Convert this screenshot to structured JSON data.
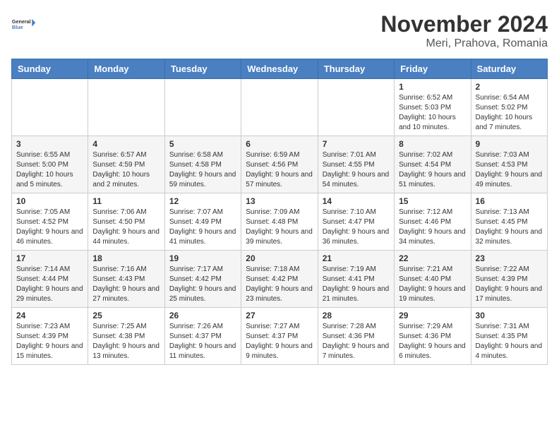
{
  "logo": {
    "line1": "General",
    "line2": "Blue"
  },
  "title": "November 2024",
  "location": "Meri, Prahova, Romania",
  "days_of_week": [
    "Sunday",
    "Monday",
    "Tuesday",
    "Wednesday",
    "Thursday",
    "Friday",
    "Saturday"
  ],
  "weeks": [
    [
      {
        "day": "",
        "info": ""
      },
      {
        "day": "",
        "info": ""
      },
      {
        "day": "",
        "info": ""
      },
      {
        "day": "",
        "info": ""
      },
      {
        "day": "",
        "info": ""
      },
      {
        "day": "1",
        "info": "Sunrise: 6:52 AM\nSunset: 5:03 PM\nDaylight: 10 hours and 10 minutes."
      },
      {
        "day": "2",
        "info": "Sunrise: 6:54 AM\nSunset: 5:02 PM\nDaylight: 10 hours and 7 minutes."
      }
    ],
    [
      {
        "day": "3",
        "info": "Sunrise: 6:55 AM\nSunset: 5:00 PM\nDaylight: 10 hours and 5 minutes."
      },
      {
        "day": "4",
        "info": "Sunrise: 6:57 AM\nSunset: 4:59 PM\nDaylight: 10 hours and 2 minutes."
      },
      {
        "day": "5",
        "info": "Sunrise: 6:58 AM\nSunset: 4:58 PM\nDaylight: 9 hours and 59 minutes."
      },
      {
        "day": "6",
        "info": "Sunrise: 6:59 AM\nSunset: 4:56 PM\nDaylight: 9 hours and 57 minutes."
      },
      {
        "day": "7",
        "info": "Sunrise: 7:01 AM\nSunset: 4:55 PM\nDaylight: 9 hours and 54 minutes."
      },
      {
        "day": "8",
        "info": "Sunrise: 7:02 AM\nSunset: 4:54 PM\nDaylight: 9 hours and 51 minutes."
      },
      {
        "day": "9",
        "info": "Sunrise: 7:03 AM\nSunset: 4:53 PM\nDaylight: 9 hours and 49 minutes."
      }
    ],
    [
      {
        "day": "10",
        "info": "Sunrise: 7:05 AM\nSunset: 4:52 PM\nDaylight: 9 hours and 46 minutes."
      },
      {
        "day": "11",
        "info": "Sunrise: 7:06 AM\nSunset: 4:50 PM\nDaylight: 9 hours and 44 minutes."
      },
      {
        "day": "12",
        "info": "Sunrise: 7:07 AM\nSunset: 4:49 PM\nDaylight: 9 hours and 41 minutes."
      },
      {
        "day": "13",
        "info": "Sunrise: 7:09 AM\nSunset: 4:48 PM\nDaylight: 9 hours and 39 minutes."
      },
      {
        "day": "14",
        "info": "Sunrise: 7:10 AM\nSunset: 4:47 PM\nDaylight: 9 hours and 36 minutes."
      },
      {
        "day": "15",
        "info": "Sunrise: 7:12 AM\nSunset: 4:46 PM\nDaylight: 9 hours and 34 minutes."
      },
      {
        "day": "16",
        "info": "Sunrise: 7:13 AM\nSunset: 4:45 PM\nDaylight: 9 hours and 32 minutes."
      }
    ],
    [
      {
        "day": "17",
        "info": "Sunrise: 7:14 AM\nSunset: 4:44 PM\nDaylight: 9 hours and 29 minutes."
      },
      {
        "day": "18",
        "info": "Sunrise: 7:16 AM\nSunset: 4:43 PM\nDaylight: 9 hours and 27 minutes."
      },
      {
        "day": "19",
        "info": "Sunrise: 7:17 AM\nSunset: 4:42 PM\nDaylight: 9 hours and 25 minutes."
      },
      {
        "day": "20",
        "info": "Sunrise: 7:18 AM\nSunset: 4:42 PM\nDaylight: 9 hours and 23 minutes."
      },
      {
        "day": "21",
        "info": "Sunrise: 7:19 AM\nSunset: 4:41 PM\nDaylight: 9 hours and 21 minutes."
      },
      {
        "day": "22",
        "info": "Sunrise: 7:21 AM\nSunset: 4:40 PM\nDaylight: 9 hours and 19 minutes."
      },
      {
        "day": "23",
        "info": "Sunrise: 7:22 AM\nSunset: 4:39 PM\nDaylight: 9 hours and 17 minutes."
      }
    ],
    [
      {
        "day": "24",
        "info": "Sunrise: 7:23 AM\nSunset: 4:39 PM\nDaylight: 9 hours and 15 minutes."
      },
      {
        "day": "25",
        "info": "Sunrise: 7:25 AM\nSunset: 4:38 PM\nDaylight: 9 hours and 13 minutes."
      },
      {
        "day": "26",
        "info": "Sunrise: 7:26 AM\nSunset: 4:37 PM\nDaylight: 9 hours and 11 minutes."
      },
      {
        "day": "27",
        "info": "Sunrise: 7:27 AM\nSunset: 4:37 PM\nDaylight: 9 hours and 9 minutes."
      },
      {
        "day": "28",
        "info": "Sunrise: 7:28 AM\nSunset: 4:36 PM\nDaylight: 9 hours and 7 minutes."
      },
      {
        "day": "29",
        "info": "Sunrise: 7:29 AM\nSunset: 4:36 PM\nDaylight: 9 hours and 6 minutes."
      },
      {
        "day": "30",
        "info": "Sunrise: 7:31 AM\nSunset: 4:35 PM\nDaylight: 9 hours and 4 minutes."
      }
    ]
  ]
}
